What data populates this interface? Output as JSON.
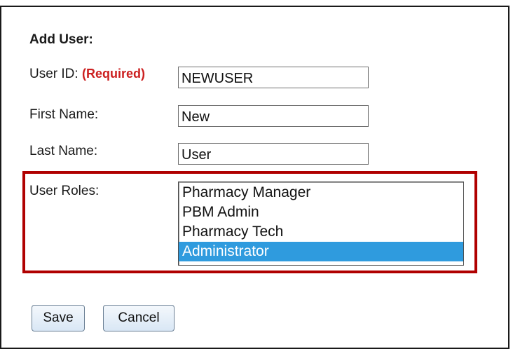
{
  "form": {
    "title": "Add User:",
    "user_id": {
      "label": "User ID:",
      "required_note": "(Required)",
      "value": "NEWUSER"
    },
    "first_name": {
      "label": "First Name:",
      "value": "New"
    },
    "last_name": {
      "label": "Last Name:",
      "value": "User"
    },
    "user_roles": {
      "label": "User Roles:",
      "options": [
        "Pharmacy Manager",
        "PBM Admin",
        "Pharmacy Tech",
        "Administrator"
      ],
      "selected": "Administrator"
    }
  },
  "buttons": {
    "save_label": "Save",
    "cancel_label": "Cancel"
  },
  "colors": {
    "highlight_border": "#b00000",
    "required_text": "#cc1f1f",
    "selected_option_bg": "#2f9bde"
  }
}
